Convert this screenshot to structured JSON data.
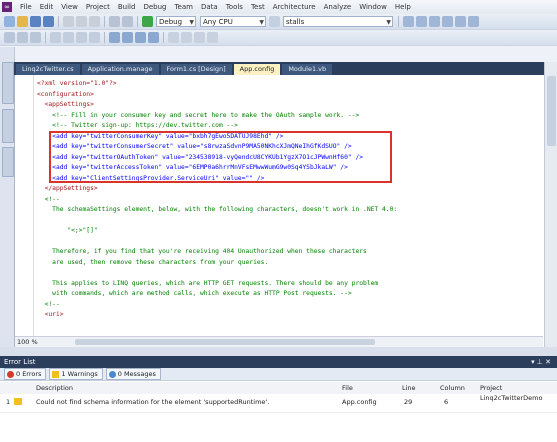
{
  "menubar": {
    "items": [
      "File",
      "Edit",
      "View",
      "Project",
      "Build",
      "Debug",
      "Team",
      "Data",
      "Tools",
      "Test",
      "Architecture",
      "Analyze",
      "Window",
      "Help"
    ]
  },
  "toolbar": {
    "config_select": "Debug",
    "platform_select": "Any CPU",
    "find_select": "stalls"
  },
  "doc_tabs": [
    {
      "label": "Linq2cTwitter.cs",
      "active": false
    },
    {
      "label": "Application.manage",
      "active": false
    },
    {
      "label": "Form1.cs [Design]",
      "active": false
    },
    {
      "label": "App.config",
      "active": true
    },
    {
      "label": "Module1.vb",
      "active": false
    }
  ],
  "editor": {
    "zoom": "100 %",
    "lines": [
      {
        "text": "<?xml version=\"1.0\"?>",
        "kind": "tag",
        "indent": 1
      },
      {
        "text": "<configuration>",
        "kind": "tag",
        "indent": 1
      },
      {
        "text": "  <appSettings>",
        "kind": "tag",
        "indent": 2
      },
      {
        "text": "    <!-- Fill in your consumer key and secret here to make the OAuth sample work. -->",
        "kind": "com",
        "indent": 3
      },
      {
        "text": "    <!-- Twitter sign-up: https://dev.twitter.com -->",
        "kind": "com",
        "indent": 3
      },
      {
        "text": "    <add key=\"twitterConsumerKey\" value=\"bxbh7gEwo5DATUJ98Ehd\" />",
        "kind": "add",
        "indent": 3
      },
      {
        "text": "    <add key=\"twitterConsumerSecret\" value=\"s8rwzaSdvnP9MA50NKhcXJmQNeIhGfKdSUO\" />",
        "kind": "add",
        "indent": 3
      },
      {
        "text": "    <add key=\"twitterOAuthToken\" value=\"234538918-vyQendcU8CYKUb1YgzX7O1cJPWwnHf60\" />",
        "kind": "add",
        "indent": 3
      },
      {
        "text": "    <add key=\"twitterAccessToken\" value=\"6EMP0a6hrrMnVFsEMwwWumG9w0Sq4YSbJkaLW\" />",
        "kind": "add",
        "indent": 3
      },
      {
        "text": "    <add key=\"ClientSettingsProvider.ServiceUri\" value=\"\" />",
        "kind": "add",
        "indent": 3
      },
      {
        "text": "  </appSettings>",
        "kind": "tag",
        "indent": 2
      },
      {
        "text": "  <!--",
        "kind": "com",
        "indent": 2
      },
      {
        "text": "    The schemaSettings element, below, with the following characters, doesn't work in .NET 4.0:",
        "kind": "com",
        "indent": 3
      },
      {
        "text": "",
        "kind": "com",
        "indent": 3
      },
      {
        "text": "        \"<;>\"[]\"",
        "kind": "com",
        "indent": 3
      },
      {
        "text": "",
        "kind": "com",
        "indent": 3
      },
      {
        "text": "    Therefore, if you find that you're receiving 404 Unauthorized when these characters",
        "kind": "com",
        "indent": 3
      },
      {
        "text": "    are used, then remove these characters from your queries.",
        "kind": "com",
        "indent": 3
      },
      {
        "text": "",
        "kind": "com",
        "indent": 3
      },
      {
        "text": "    This applies to LINQ queries, which are HTTP GET requests. There should be any problem",
        "kind": "com",
        "indent": 3
      },
      {
        "text": "    with commands, which are method calls, which execute as HTTP Post requests. -->",
        "kind": "com",
        "indent": 3
      },
      {
        "text": "  <!--",
        "kind": "com",
        "indent": 2
      },
      {
        "text": "  <uri>",
        "kind": "tag",
        "indent": 2
      }
    ]
  },
  "error_list": {
    "title": "Error List",
    "filters": {
      "errors": "0 Errors",
      "warnings": "1 Warnings",
      "messages": "0 Messages"
    },
    "columns": {
      "description": "Description",
      "file": "File",
      "line": "Line",
      "column": "Column",
      "project": "Project"
    },
    "rows": [
      {
        "index": "1",
        "description": "Could not find schema information for the element 'supportedRuntime'.",
        "file": "App.config",
        "line": "29",
        "column": "6",
        "project": "Linq2cTwitterDemo"
      }
    ]
  }
}
